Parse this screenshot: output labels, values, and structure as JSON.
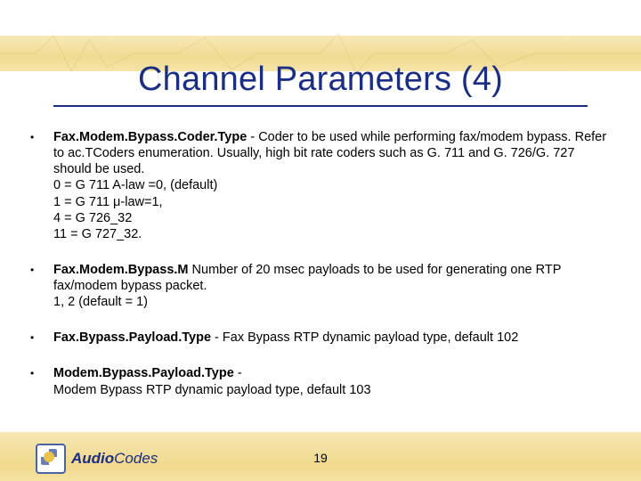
{
  "title": "Channel Parameters (4)",
  "bullets": [
    {
      "term": "Fax.Modem.Bypass.Coder.Type",
      "sep": " - ",
      "body": "Coder to be used while performing fax/modem bypass. Refer to ac.TCoders enumeration. Usually, high bit rate coders such as G. 711 and G. 726/G. 727 should be used.",
      "lines": [
        "0 = G 711 A-law =0, (default)",
        "1 = G 711 μ-law=1,",
        "4 = G 726_32",
        "11 = G 727_32."
      ]
    },
    {
      "term": "Fax.Modem.Bypass.M",
      "sep": " ",
      "body": "Number of 20 msec payloads to be used for generating one RTP fax/modem bypass packet.",
      "lines": [
        "1, 2 (default = 1)"
      ]
    },
    {
      "term": "Fax.Bypass.Payload.Type",
      "sep": "  - ",
      "body": "Fax Bypass RTP dynamic payload type, default 102",
      "lines": []
    },
    {
      "term": "Modem.Bypass.Payload.Type",
      "sep": " -",
      "body": "",
      "lines": [
        "Modem Bypass RTP dynamic payload type, default 103"
      ]
    }
  ],
  "logo": {
    "brand_a": "Audio",
    "brand_b": "Codes"
  },
  "page_number": "19"
}
